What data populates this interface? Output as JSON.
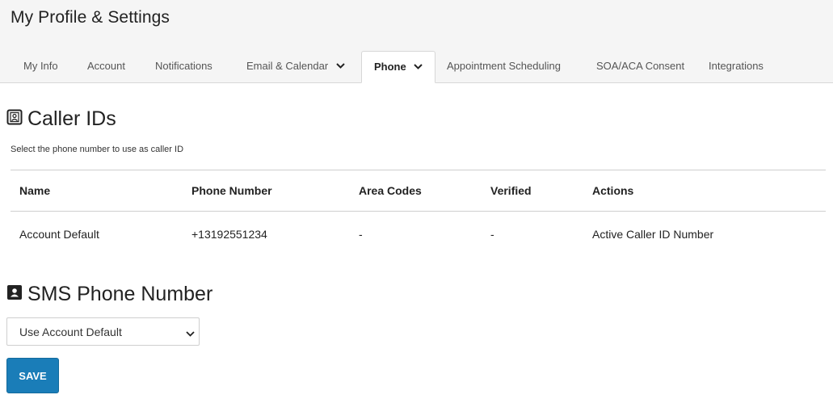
{
  "page": {
    "title": "My Profile & Settings"
  },
  "tabs": [
    {
      "label": "My Info"
    },
    {
      "label": "Account"
    },
    {
      "label": "Notifications"
    },
    {
      "label": "Email & Calendar"
    },
    {
      "label": "Phone"
    },
    {
      "label": "Appointment Scheduling"
    },
    {
      "label": "SOA/ACA Consent"
    },
    {
      "label": "Integrations"
    }
  ],
  "active_tab": "Phone",
  "caller_ids": {
    "title": "Caller IDs",
    "subtitle": "Select the phone number to use as caller ID",
    "columns": [
      "Name",
      "Phone Number",
      "Area Codes",
      "Verified",
      "Actions"
    ],
    "rows": [
      {
        "name": "Account Default",
        "phone": "+13192551234",
        "area_codes": "-",
        "verified": "-",
        "actions": "Active Caller ID Number"
      }
    ]
  },
  "sms": {
    "title": "SMS Phone Number",
    "select_value": "Use Account Default"
  },
  "save_label": "SAVE",
  "icons": {
    "section": "contact-card-icon",
    "dropdown": "chevron-down-icon"
  },
  "colors": {
    "save_button": "#1a7db8",
    "header_bg": "#f5f5f5"
  }
}
